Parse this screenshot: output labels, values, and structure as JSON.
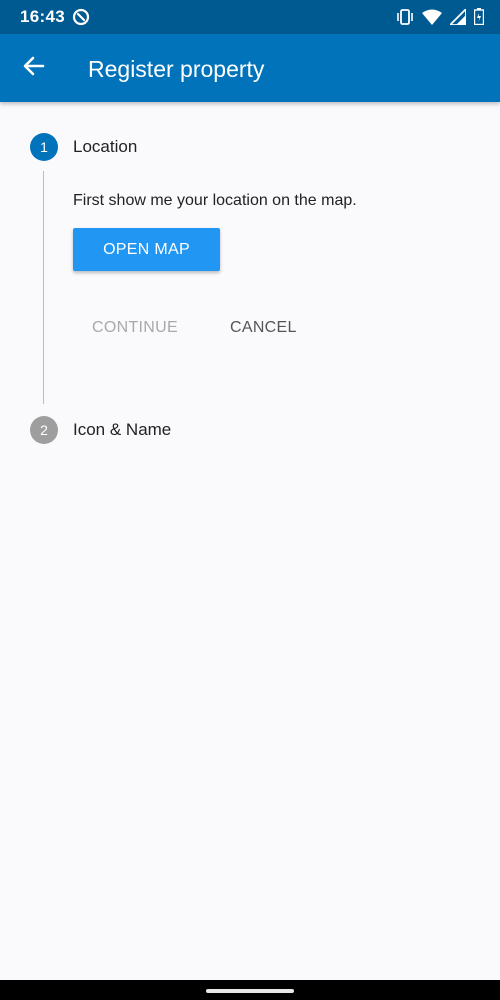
{
  "status_bar": {
    "time": "16:43",
    "icons": [
      "app-notification-icon",
      "vibrate-icon",
      "wifi-icon",
      "signal-icon",
      "battery-icon"
    ]
  },
  "app_bar": {
    "title": "Register property",
    "back_icon": "arrow-back-icon"
  },
  "stepper": {
    "steps": [
      {
        "number": "1",
        "label": "Location",
        "description": "First show me your location on the map.",
        "action_label": "OPEN MAP",
        "continue_label": "CONTINUE",
        "cancel_label": "CANCEL",
        "active": true
      },
      {
        "number": "2",
        "label": "Icon & Name",
        "active": false
      }
    ]
  },
  "colors": {
    "status_bar": "#005a92",
    "app_bar": "#0073ba",
    "active_step": "#0073ba",
    "inactive_step": "#9e9e9e",
    "primary_button": "#2196f3",
    "background": "#faf9fc"
  }
}
